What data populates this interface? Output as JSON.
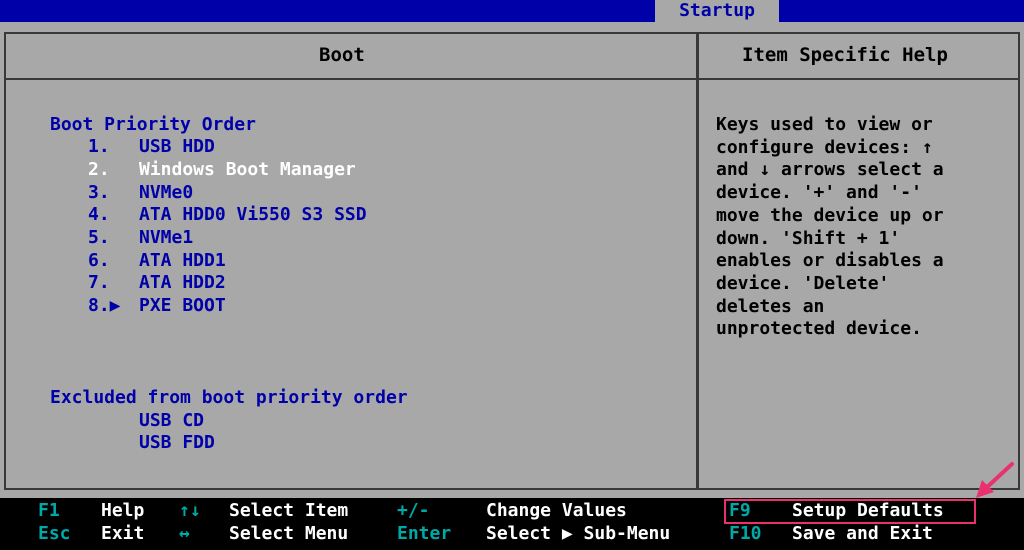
{
  "header": {
    "active_tab": "Startup"
  },
  "boot_panel": {
    "title": "Boot",
    "priority_heading": "Boot Priority Order",
    "items": [
      {
        "num": "1.",
        "label": "USB HDD",
        "selected": false
      },
      {
        "num": "2.",
        "label": "Windows Boot Manager",
        "selected": true
      },
      {
        "num": "3.",
        "label": "NVMe0",
        "selected": false
      },
      {
        "num": "4.",
        "label": "ATA HDD0 Vi550 S3 SSD",
        "selected": false
      },
      {
        "num": "5.",
        "label": "NVMe1",
        "selected": false
      },
      {
        "num": "6.",
        "label": "ATA HDD1",
        "selected": false
      },
      {
        "num": "7.",
        "label": "ATA HDD2",
        "selected": false
      },
      {
        "num": "8.▶",
        "label": "PXE BOOT",
        "selected": false
      }
    ],
    "excluded_heading": "Excluded from boot priority order",
    "excluded_items": [
      "USB CD",
      "USB FDD"
    ]
  },
  "help_panel": {
    "title": "Item Specific Help",
    "text": "Keys used to view or\nconfigure devices: ↑\nand ↓ arrows select a\ndevice. '+' and '-'\nmove the device up or\ndown. 'Shift + 1'\nenables or disables a\ndevice. 'Delete'\ndeletes an\nunprotected device."
  },
  "footer": {
    "row1": [
      {
        "key": "F1",
        "desc": "Help"
      },
      {
        "key": "↑↓",
        "desc": "Select Item"
      },
      {
        "key": "+/-",
        "desc": "Change Values"
      },
      {
        "key": "F9",
        "desc": "Setup Defaults"
      }
    ],
    "row2": [
      {
        "key": "Esc",
        "desc": "Exit"
      },
      {
        "key": "↔",
        "desc": "Select Menu"
      },
      {
        "key": "Enter",
        "desc": "Select ▶ Sub-Menu"
      },
      {
        "key": "F10",
        "desc": "Save and Exit"
      }
    ]
  },
  "colors": {
    "header_bg": "#0000a8",
    "panel_bg": "#a8a8a8",
    "item_text": "#0000a8",
    "selected_text": "#ffffff",
    "footer_key": "#00a8a8",
    "highlight": "#e8316e"
  }
}
